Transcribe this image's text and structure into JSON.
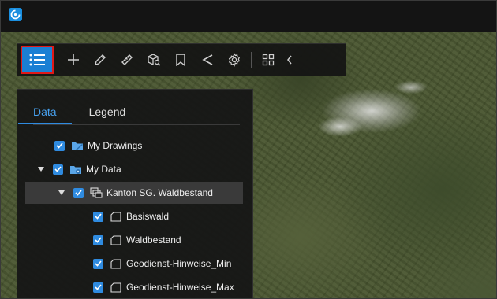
{
  "colors": {
    "accent": "#2f8be0",
    "topbar": "#141414",
    "panel": "#161616",
    "highlight_border": "#e01818"
  },
  "topbar": {
    "logo_icon": "app-logo-icon"
  },
  "toolbar": {
    "buttons": [
      {
        "name": "layers-list-icon",
        "selected": true
      },
      {
        "name": "plus-icon"
      },
      {
        "name": "pencil-icon"
      },
      {
        "name": "ruler-icon"
      },
      {
        "name": "cube-search-icon"
      },
      {
        "name": "bookmark-icon"
      },
      {
        "name": "share-icon"
      },
      {
        "name": "gear-icon"
      },
      {
        "name": "grid-icon"
      },
      {
        "name": "chevron-left-icon"
      }
    ]
  },
  "panel": {
    "tabs": [
      {
        "label": "Data",
        "active": true
      },
      {
        "label": "Legend",
        "active": false
      }
    ],
    "tree": [
      {
        "label": "My Drawings",
        "checked": true,
        "icon": "drawings-folder-icon"
      },
      {
        "label": "My Data",
        "checked": true,
        "expanded": true,
        "icon": "data-folder-icon"
      },
      {
        "label": "Kanton SG. Waldbestand",
        "checked": true,
        "expanded": true,
        "selected": true,
        "icon": "layer-group-icon"
      },
      {
        "label": "Basiswald",
        "checked": true,
        "icon": "polygon-layer-icon"
      },
      {
        "label": "Waldbestand",
        "checked": true,
        "icon": "polygon-layer-icon"
      },
      {
        "label": "Geodienst-Hinweise_Min",
        "checked": true,
        "icon": "polygon-layer-icon"
      },
      {
        "label": "Geodienst-Hinweise_Max",
        "checked": true,
        "icon": "polygon-layer-icon"
      }
    ]
  }
}
